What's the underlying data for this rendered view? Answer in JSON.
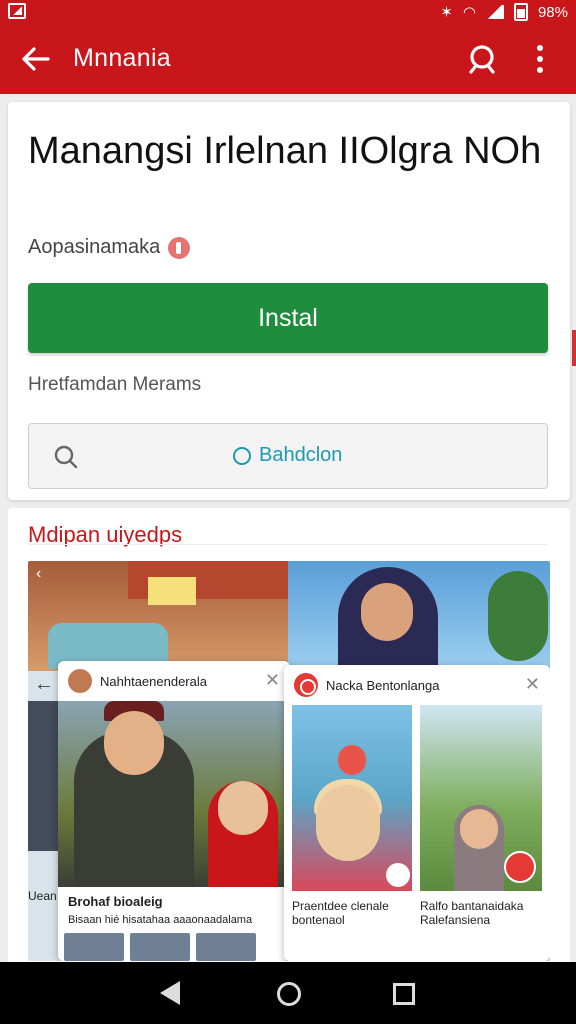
{
  "status_bar": {
    "battery": "98%"
  },
  "app_bar": {
    "title": "Mnnania"
  },
  "app": {
    "title": "Manangsi Irlelnan IIOlgra NOh",
    "publisher": "Aopasinamaka",
    "install_label": "Instal",
    "info": "Hretfamdan Merams",
    "search_button": "Bahdclon"
  },
  "media": {
    "section_title": "Mdipan uiyedps",
    "left_dialog": {
      "name": "Nahhtaenenderala",
      "caption": "Brohaf bioaleig",
      "subcaption": "Bisaan hié hisatahaa aaaonaadalama"
    },
    "right_dialog": {
      "name": "Nacka Bentonlanga",
      "caption_a": "Praentdee clenale bontenaol",
      "caption_b": "Ralfo bantanaidaka Ralefansiena"
    },
    "left_edge_text": "Uean Icnh Areasm"
  },
  "colors": {
    "primary": "#c8161a",
    "install": "#1e8e3e",
    "link": "#1a9bb5"
  },
  "icons": {
    "back": "arrow-left-icon",
    "search": "search-icon",
    "menu": "more-vert-icon",
    "publisher_badge": "badge-icon",
    "search_box": "magnifier-icon",
    "circle": "circle-icon"
  }
}
